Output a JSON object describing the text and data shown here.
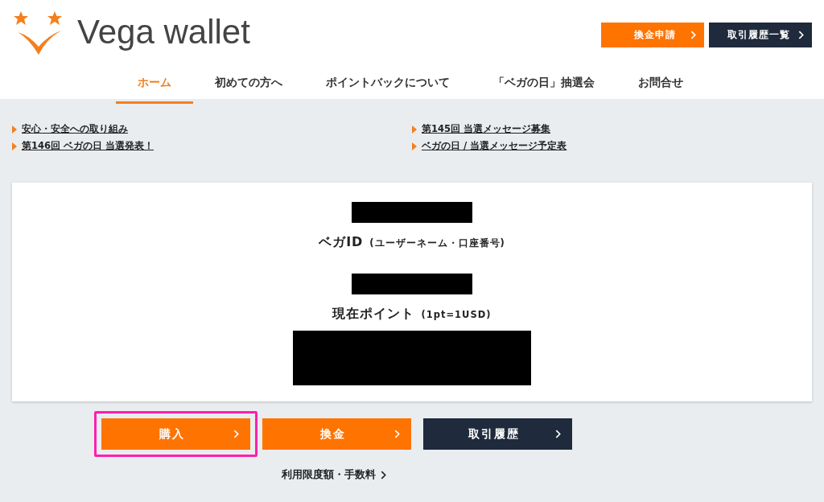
{
  "logo": {
    "text": "Vega wallet"
  },
  "header_buttons": [
    {
      "label": "換金申請",
      "kind": "primary"
    },
    {
      "label": "取引履歴一覧",
      "kind": "dark"
    }
  ],
  "nav": [
    {
      "label": "ホーム",
      "selected": true
    },
    {
      "label": "初めての方へ",
      "selected": false
    },
    {
      "label": "ポイントバックについて",
      "selected": false
    },
    {
      "label": "「ベガの日」抽選会",
      "selected": false
    },
    {
      "label": "お問合せ",
      "selected": false
    }
  ],
  "news_links": [
    {
      "text": "安心・安全への取り組み"
    },
    {
      "text": "第145回 当選メッセージ募集"
    },
    {
      "text": "第146回 ベガの日 当選発表！"
    },
    {
      "text": "ベガの日 / 当選メッセージ予定表"
    }
  ],
  "account": {
    "id_label": "ベガID",
    "id_note": "(ユーザーネーム・口座番号)",
    "points_label": "現在ポイント",
    "points_note": "(1pt=1USD)"
  },
  "actions": [
    {
      "label": "購入",
      "kind": "primary",
      "highlighted": true
    },
    {
      "label": "換金",
      "kind": "primary",
      "highlighted": false
    },
    {
      "label": "取引履歴",
      "kind": "dark",
      "highlighted": false
    }
  ],
  "footer_link": {
    "text": "利用限度額・手数料"
  }
}
